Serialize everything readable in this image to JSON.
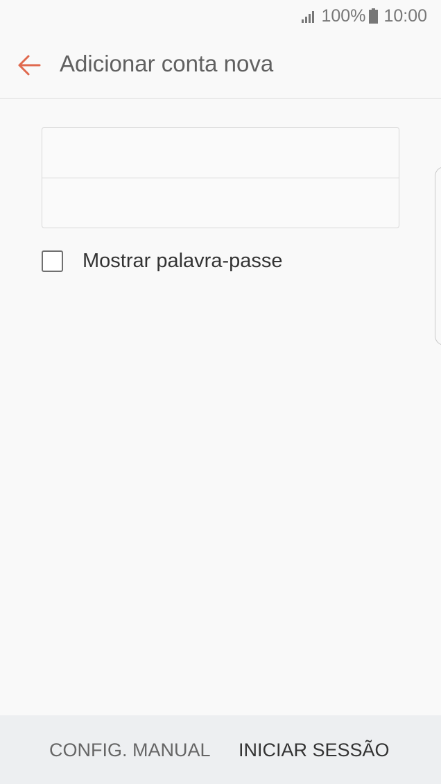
{
  "status_bar": {
    "battery_percent": "100%",
    "time": "10:00",
    "icons": [
      "signal-icon",
      "battery-icon"
    ]
  },
  "app_bar": {
    "title": "Adicionar conta nova",
    "back_icon": "arrow-left-icon",
    "accent_color": "#e0694e"
  },
  "form": {
    "email": {
      "value": "",
      "placeholder": ""
    },
    "password": {
      "value": "",
      "placeholder": ""
    },
    "show_password": {
      "label": "Mostrar palavra-passe",
      "checked": false
    }
  },
  "bottom_bar": {
    "manual_setup_label": "CONFIG. MANUAL",
    "sign_in_label": "INICIAR SESSÃO"
  }
}
